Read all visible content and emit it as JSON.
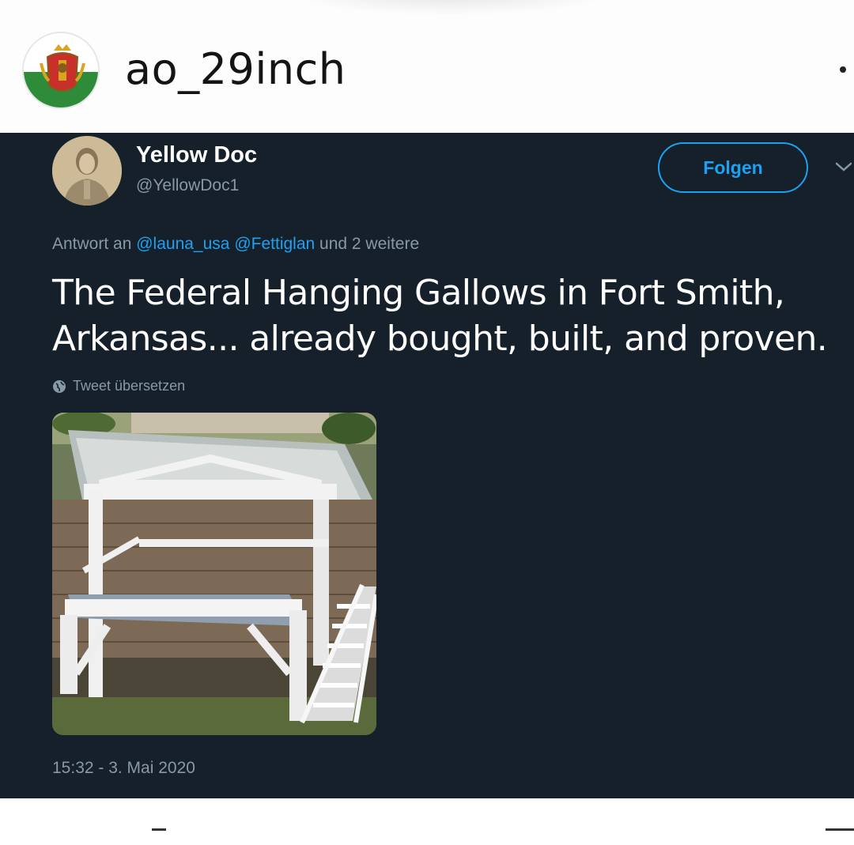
{
  "instagram": {
    "username": "ao_29inch",
    "avatar_icon": "coat-of-arms-icon",
    "more_icon": "more-options-icon"
  },
  "tweet": {
    "author_name": "Yellow Doc",
    "author_handle": "@YellowDoc1",
    "follow_label": "Folgen",
    "reply_prefix": "Antwort an",
    "reply_mention_1": "@launa_usa",
    "reply_mention_2": "@Fettiglan",
    "reply_suffix": "und 2 weitere",
    "text": "The Federal Hanging Gallows in Fort Smith, Arkansas... already bought, built, and proven.",
    "translate_label": "Tweet übersetzen",
    "timestamp": "15:32 - 3. Mai 2020",
    "colors": {
      "background": "#15202b",
      "accent": "#1da1f2",
      "secondary_text": "#8899a6"
    }
  }
}
